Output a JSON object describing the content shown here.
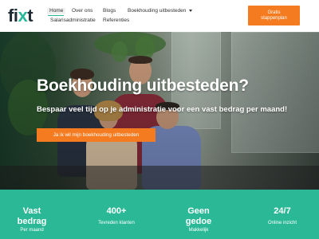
{
  "brand": {
    "logo_prefix": "fi",
    "logo_x": "x",
    "logo_suffix": "t"
  },
  "nav": {
    "home": "Home",
    "over_ons": "Over ons",
    "blogs": "Blogs",
    "boekhouding": "Boekhouding uitbesteden",
    "salaris": "Salarisadministratie",
    "referenties": "Referenties"
  },
  "cta": {
    "line1": "Gratis",
    "line2": "stappenplan"
  },
  "hero": {
    "title": "Boekhouding uitbesteden?",
    "subtitle": "Bespaar veel tijd op je administratie voor een vast bedrag per maand!",
    "button": "Ja ik wil mijn boekhouding uitbesteden"
  },
  "stats": [
    {
      "big": "Vast",
      "big2": "bedrag",
      "small": "Per maand"
    },
    {
      "big": "400+",
      "small": "Tevreden klanten"
    },
    {
      "big": "Geen",
      "big2": "gedoe",
      "small": "Makkelijk"
    },
    {
      "big": "24/7",
      "small": "Online inzicht"
    }
  ],
  "colors": {
    "accent": "#f47b20",
    "brand_green": "#2ab896",
    "logo_dark": "#1e2a33"
  },
  "icons": [
    "caret-down-icon"
  ]
}
